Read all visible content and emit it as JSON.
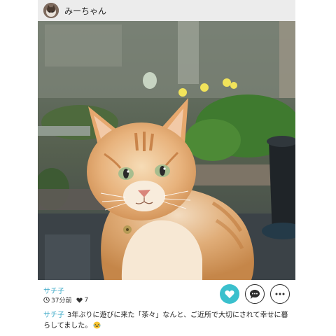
{
  "header": {
    "username": "みーちゃん",
    "avatar_icon": "cat-avatar"
  },
  "photo": {
    "subject": "orange-tabby-cat-in-garden"
  },
  "post": {
    "author": "サチ子",
    "time_ago": "37分前",
    "like_count": "7",
    "caption_author": "サチ子",
    "caption_text": "3年ぶりに遊びに来た「茶々」なんと、ご近所で大切にされて幸せに暮らしてました。",
    "caption_emoji": "laughing-tears-emoji"
  },
  "actions": {
    "like_icon": "heart-icon",
    "comment_icon": "speech-bubble-icon",
    "more_icon": "ellipsis-icon"
  },
  "colors": {
    "accent": "#3bc0cd",
    "author_link": "#3aa8c6",
    "header_bg": "#ececec"
  }
}
